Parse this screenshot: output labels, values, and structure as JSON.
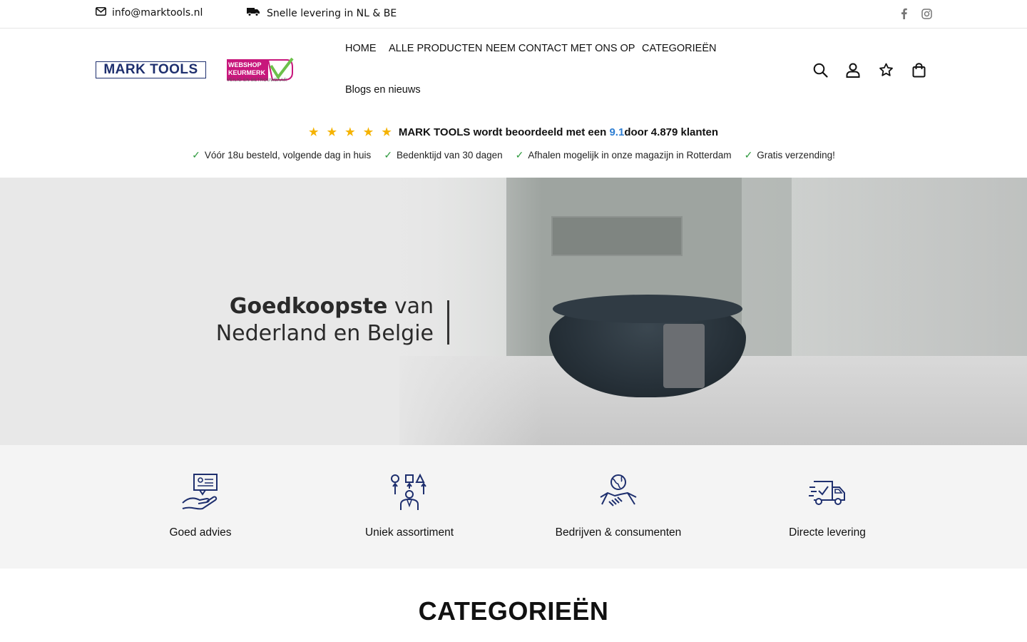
{
  "topbar": {
    "email": "info@marktools.nl",
    "delivery": "Snelle levering in NL & BE",
    "socials": [
      "facebook-icon",
      "instagram-icon"
    ]
  },
  "header": {
    "logo_text": "MARK TOOLS",
    "keurmerk": {
      "line1": "WEBSHOP",
      "line2": "KEURMERK",
      "tagline": "VEILIG EN BETROUWBAAR"
    },
    "nav": [
      "HOME",
      "ALLE PRODUCTEN",
      "NEEM CONTACT MET ONS OP",
      "CATEGORIEËN",
      "Blogs en nieuws"
    ],
    "icons": [
      "search-icon",
      "account-icon",
      "wishlist-icon",
      "cart-icon"
    ]
  },
  "rating": {
    "stars": "★ ★ ★ ★ ★",
    "text_before": "MARK TOOLS wordt beoordeeld  met een ",
    "score": "9.1",
    "text_after": "door 4.879 klanten"
  },
  "usps": [
    "Vóór 18u besteld, volgende dag in huis",
    "Bedenktijd van 30 dagen",
    "Afhalen mogelijk in onze magazijn in Rotterdam",
    "Gratis verzending!"
  ],
  "hero": {
    "line1_bold": "Goedkoopste",
    "line1_rest": " van",
    "line2": "Nederland en Belgie"
  },
  "features": [
    {
      "icon": "advice-icon",
      "label": "Goed advies"
    },
    {
      "icon": "assortment-icon",
      "label": "Uniek assortiment"
    },
    {
      "icon": "handshake-icon",
      "label": "Bedrijven & consumenten"
    },
    {
      "icon": "delivery-truck-icon",
      "label": "Directe levering"
    }
  ],
  "section": {
    "title": "CATEGORIEËN"
  },
  "colors": {
    "brand_blue": "#1e2f6e",
    "keurmerk_pink": "#c8177c",
    "star_gold": "#f5b301",
    "score_blue": "#2d7dd2",
    "check_green": "#2e9a3e"
  }
}
